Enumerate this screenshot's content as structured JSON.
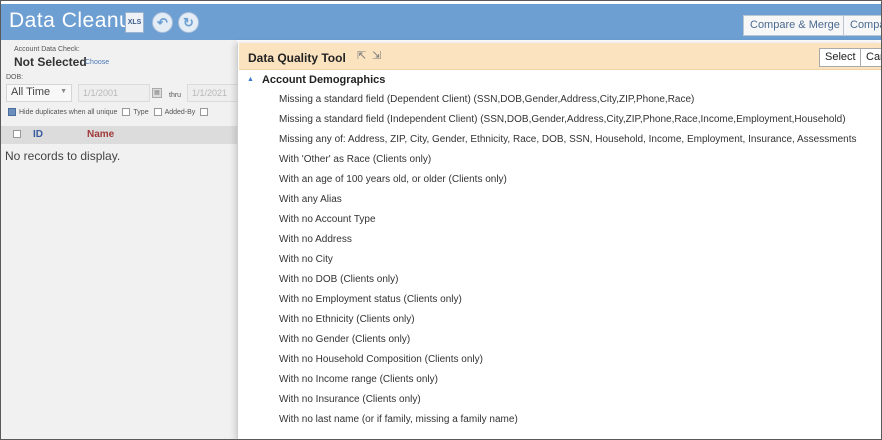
{
  "app": {
    "title": "Data Cleanup",
    "xls_icon_label": "XLS",
    "icons": [
      "xls-export-icon",
      "back-arrow-icon",
      "refresh-icon"
    ]
  },
  "toolbar": {
    "compare_merge": "Compare & Merge",
    "compare": "Compa"
  },
  "filters": {
    "account_check_label": "Account Data Check:",
    "account_check_value": "Not Selected",
    "choose_link": "Choose",
    "dob_label": "DOB:",
    "range_value": "All Time",
    "from_date": "1/1/2001",
    "thru_label": "thru",
    "to_date": "1/1/2021",
    "hide_duplicates": "Hide duplicates when all unique",
    "type_label": "Type",
    "added_by_label": "Added-By"
  },
  "grid": {
    "col_id": "ID",
    "col_name": "Name",
    "empty": "No records to display."
  },
  "modal": {
    "title": "Data Quality Tool",
    "select_button": "Select",
    "cancel_button": "Can",
    "section": "Account Demographics",
    "items": [
      "Missing a standard field (Dependent Client) (SSN,DOB,Gender,Address,City,ZIP,Phone,Race)",
      "Missing a standard field (Independent Client) (SSN,DOB,Gender,Address,City,ZIP,Phone,Race,Income,Employment,Household)",
      "Missing any of: Address, ZIP, City, Gender, Ethnicity, Race, DOB, SSN, Household, Income, Employment, Insurance, Assessments",
      "With 'Other' as Race (Clients only)",
      "With an age of 100 years old, or older (Clients only)",
      "With any Alias",
      "With no Account Type",
      "With no Address",
      "With no City",
      "With no DOB (Clients only)",
      "With no Employment status (Clients only)",
      "With no Ethnicity (Clients only)",
      "With no Gender (Clients only)",
      "With no Household Composition (Clients only)",
      "With no Income range (Clients only)",
      "With no Insurance (Clients only)",
      "With no last name (or if family, missing a family name)"
    ]
  },
  "colors": {
    "topbar": "#6d9fd2",
    "modal_header": "#fbe3c0",
    "section_triangle": "#3a7ac8"
  }
}
